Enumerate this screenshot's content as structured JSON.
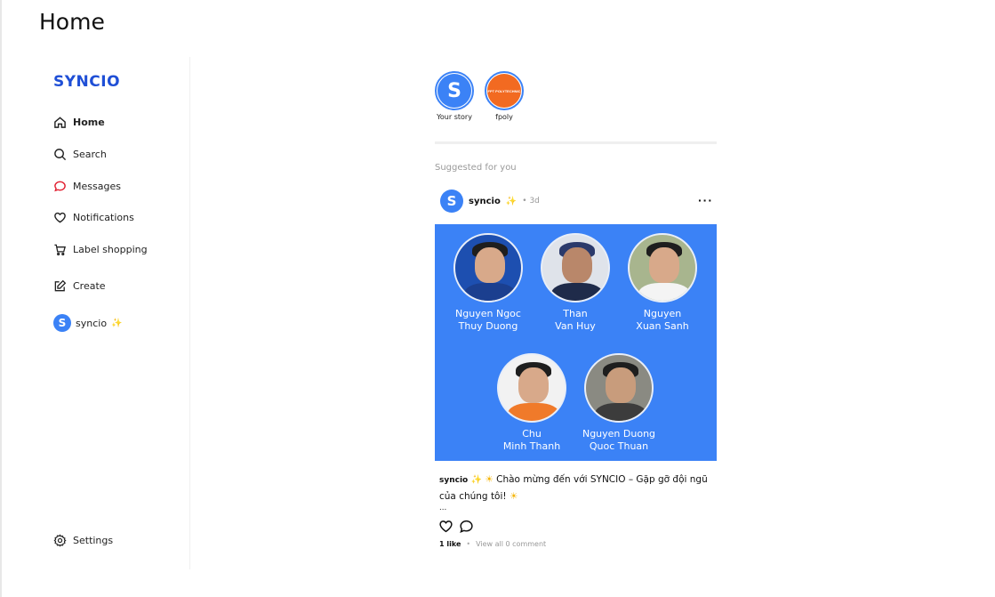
{
  "page": {
    "title": "Home"
  },
  "sidebar": {
    "logo": "SYNCIO",
    "items": [
      {
        "label": "Home",
        "icon": "home-icon"
      },
      {
        "label": "Search",
        "icon": "search-icon"
      },
      {
        "label": "Messages",
        "icon": "messages-icon"
      },
      {
        "label": "Notifications",
        "icon": "heart-icon"
      },
      {
        "label": "Label shopping",
        "icon": "cart-icon"
      },
      {
        "label": "Create",
        "icon": "create-icon"
      }
    ],
    "profile": {
      "avatar_letter": "S",
      "label": "syncio"
    },
    "settings": {
      "label": "Settings",
      "icon": "gear-icon"
    }
  },
  "stories": [
    {
      "label": "Your story",
      "letter": "S"
    },
    {
      "label": "fpoly",
      "badge": "FPT POLYTECHNIC"
    }
  ],
  "suggested_label": "Suggested for you",
  "post": {
    "user": "syncio",
    "avatar_letter": "S",
    "time": "3d",
    "members": [
      {
        "line1": "Nguyen Ngoc",
        "line2": "Thuy Duong"
      },
      {
        "line1": "Than",
        "line2": "Van Huy"
      },
      {
        "line1": "Nguyen",
        "line2": "Xuan Sanh"
      },
      {
        "line1": "Chu",
        "line2": "Minh Thanh"
      },
      {
        "line1": "Nguyen Duong",
        "line2": "Quoc Thuan"
      }
    ],
    "caption_user": "syncio",
    "caption_text": "Chào mừng đến với SYNCIO – Gặp gỡ đội ngũ của chúng tôi!",
    "caption_more": "...",
    "likes": "1 like",
    "comments": "View all 0 comment"
  },
  "colors": {
    "brand": "#1f4fd6",
    "accent": "#3b82f6",
    "fpoly": "#f26a21"
  }
}
